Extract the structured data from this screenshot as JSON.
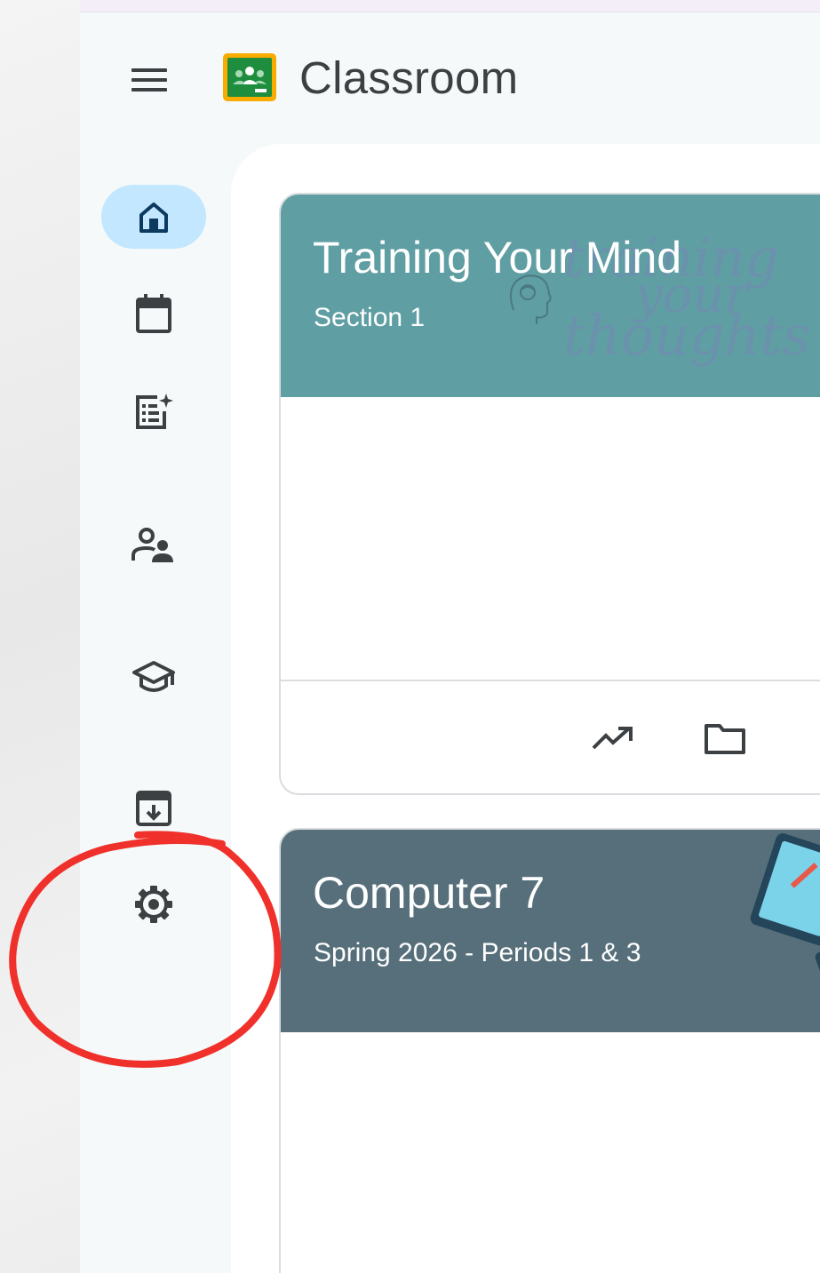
{
  "app": {
    "title": "Classroom"
  },
  "icons": {
    "menu": "hamburger-menu-icon",
    "logo": "google-classroom-logo",
    "nav": [
      "home-icon",
      "calendar-icon",
      "to-review-icon",
      "teaching-people-icon",
      "enrolled-graduation-cap-icon",
      "archived-classes-icon",
      "settings-gear-icon"
    ],
    "card_footer": [
      "trending-up-icon",
      "folder-icon"
    ]
  },
  "sidebar": {
    "active_item": "home"
  },
  "classes": [
    {
      "title": "Training Your Mind",
      "section": "Section 1",
      "banner_text": [
        "training",
        "your",
        "thoughts"
      ],
      "color": "#5f9ea3"
    },
    {
      "title": "Computer 7",
      "section": "Spring 2026 - Periods 1 & 3",
      "color": "#566f7a"
    }
  ],
  "colors": {
    "accent_active": "#c2e7ff",
    "annotation_circle": "#f0302a",
    "icon_active": "#0b3a5e",
    "icon_default": "#3c4043"
  }
}
